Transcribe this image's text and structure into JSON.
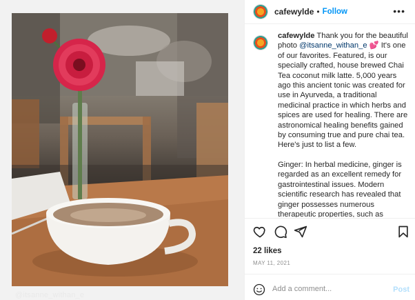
{
  "post": {
    "photo_credit": "@itsanne_withan_e",
    "header": {
      "username": "cafewylde",
      "separator": "•",
      "follow_label": "Follow",
      "more_label": "•••"
    },
    "caption": {
      "username": "cafewylde",
      "text_intro": "Thank you for the beautiful photo ",
      "mention": "@itsanne_withan_e",
      "emoji": "💕",
      "text_rest": " It's one of our favorites. Featured, is our specially crafted, house brewed Chai Tea coconut milk latte. 5,000 years ago this ancient tonic was created for use in Ayurveda, a traditional medicinal practice in which herbs and spices are used for healing. There are astronomical healing benefits gained by consuming true and pure chai tea. Here's just to list a few.",
      "paragraph_2": "Ginger: In herbal medicine, ginger is regarded as an excellent remedy for gastrointestinal issues. Modern scientific research has revealed that ginger possesses numerous therapeutic properties, such as antioxidant..."
    },
    "actions": {
      "icons": [
        "heart-icon",
        "comment-icon",
        "share-icon",
        "bookmark-icon"
      ]
    },
    "likes": "22 likes",
    "date": "MAY 11, 2021",
    "comment": {
      "placeholder": "Add a comment...",
      "post_label": "Post"
    }
  },
  "colors": {
    "accent": "#0095f6",
    "post_disabled": "#b2dffc",
    "muted": "#8e8e8e",
    "text": "#262626"
  }
}
